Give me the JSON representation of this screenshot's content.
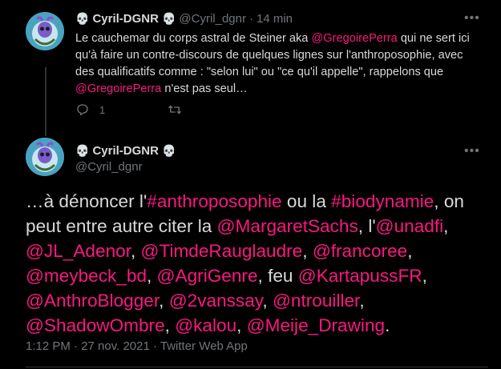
{
  "tweet1": {
    "name": "Cyril-DGNR",
    "skull": "💀",
    "handle": "@Cyril_dgnr",
    "separator": "·",
    "time": "14 min",
    "text_parts": [
      {
        "text": "Le cauchemar du corps astral de Steiner aka ",
        "mention": false
      },
      {
        "text": "@GregoirePerra",
        "mention": true
      },
      {
        "text": " qui ne sert ici qu'à faire un contre-discours de quelques lignes sur l'anthroposophie, avec des qualificatifs comme : \"selon lui\" ou \"ce qu'il appelle\", rappelons que ",
        "mention": false
      },
      {
        "text": "@GregoirePerra",
        "mention": true
      },
      {
        "text": " n'est pas seul…",
        "mention": false
      }
    ],
    "reply_count": "1",
    "icons": {
      "reply": "reply-icon",
      "retweet": "retweet-icon",
      "more": "more-icon"
    }
  },
  "tweet2": {
    "name": "Cyril-DGNR",
    "skull": "💀",
    "handle": "@Cyril_dgnr",
    "text_parts": [
      {
        "text": "…à dénoncer l'",
        "mention": false
      },
      {
        "text": "#anthroposophie",
        "mention": true
      },
      {
        "text": " ou la ",
        "mention": false
      },
      {
        "text": "#biodynamie",
        "mention": true
      },
      {
        "text": ", on peut entre autre citer la ",
        "mention": false
      },
      {
        "text": "@MargaretSachs",
        "mention": true
      },
      {
        "text": ", l'",
        "mention": false
      },
      {
        "text": "@unadfi",
        "mention": true
      },
      {
        "text": ", ",
        "mention": false
      },
      {
        "text": "@JL_Adenor",
        "mention": true
      },
      {
        "text": ", ",
        "mention": false
      },
      {
        "text": "@TimdeRauglaudre",
        "mention": true
      },
      {
        "text": ", ",
        "mention": false
      },
      {
        "text": "@francoree",
        "mention": true
      },
      {
        "text": ", ",
        "mention": false
      },
      {
        "text": "@meybeck_bd",
        "mention": true
      },
      {
        "text": ", ",
        "mention": false
      },
      {
        "text": "@AgriGenre",
        "mention": true
      },
      {
        "text": ", feu ",
        "mention": false
      },
      {
        "text": "@KartapussFR",
        "mention": true
      },
      {
        "text": ", ",
        "mention": false
      },
      {
        "text": "@AnthroBlogger",
        "mention": true
      },
      {
        "text": ", ",
        "mention": false
      },
      {
        "text": "@2vanssay",
        "mention": true
      },
      {
        "text": ", ",
        "mention": false
      },
      {
        "text": "@ntrouiller",
        "mention": true
      },
      {
        "text": ", ",
        "mention": false
      },
      {
        "text": "@ShadowOmbre",
        "mention": true
      },
      {
        "text": ", ",
        "mention": false
      },
      {
        "text": "@kalou",
        "mention": true
      },
      {
        "text": ", ",
        "mention": false
      },
      {
        "text": "@Meije_Drawing",
        "mention": true
      },
      {
        "text": ".",
        "mention": false
      }
    ],
    "timestamp": "1:12 PM · 27 nov. 2021 · Twitter Web App"
  },
  "colors": {
    "background": "#000000",
    "text": "#d9d9d9",
    "muted": "#71767b",
    "mention": "#f91880",
    "border": "#2f3336"
  }
}
